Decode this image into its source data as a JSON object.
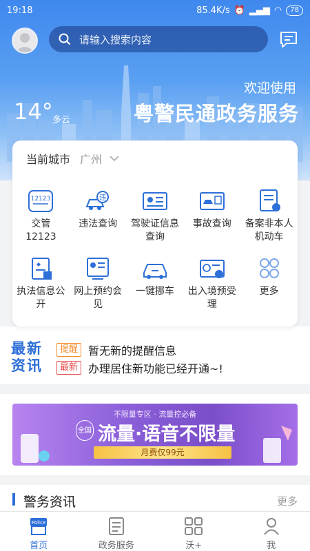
{
  "status_bar": {
    "time": "19:18",
    "net_speed": "85.4K/s",
    "battery": "78"
  },
  "search": {
    "placeholder": "请输入搜索内容"
  },
  "hero": {
    "welcome": "欢迎使用",
    "brand": "粤警民通政务服务",
    "temperature": "14°",
    "weather": "多云"
  },
  "city": {
    "label": "当前城市",
    "value": "广州"
  },
  "services": [
    {
      "label": "交管\n12123",
      "icon": "traffic-12123-icon"
    },
    {
      "label": "违法查询",
      "icon": "car-violation-icon"
    },
    {
      "label": "驾驶证信息查询",
      "icon": "license-icon"
    },
    {
      "label": "事故查询",
      "icon": "accident-icon"
    },
    {
      "label": "备案非本人机动车",
      "icon": "vehicle-record-icon"
    },
    {
      "label": "执法信息公开",
      "icon": "law-info-icon"
    },
    {
      "label": "网上预约会见",
      "icon": "appointment-icon"
    },
    {
      "label": "一键挪车",
      "icon": "move-car-icon"
    },
    {
      "label": "出入境预受理",
      "icon": "exit-entry-icon"
    },
    {
      "label": "更多",
      "icon": "more-grid-icon"
    }
  ],
  "news": {
    "logo": "最新资讯",
    "items": [
      {
        "tag": "提醒",
        "text": "暂无新的提醒信息"
      },
      {
        "tag": "最新",
        "text": "办理居住新功能已经开通~!"
      }
    ]
  },
  "banner": {
    "top": "不限量专区 · 流量控必备",
    "quan": "全国",
    "main": "流量·语音不限量",
    "price": "月费仅99元"
  },
  "police_news": {
    "title": "警务资讯",
    "more": "更多"
  },
  "tabs": [
    {
      "label": "首页",
      "icon": "police-home-icon",
      "active": true
    },
    {
      "label": "政务服务",
      "icon": "services-doc-icon",
      "active": false
    },
    {
      "label": "沃+",
      "icon": "grid-plus-icon",
      "active": false
    },
    {
      "label": "我",
      "icon": "person-icon",
      "active": false
    }
  ],
  "colors": {
    "primary": "#2d6fd8",
    "accent_orange": "#f38b2a",
    "accent_red": "#e84b4b"
  }
}
